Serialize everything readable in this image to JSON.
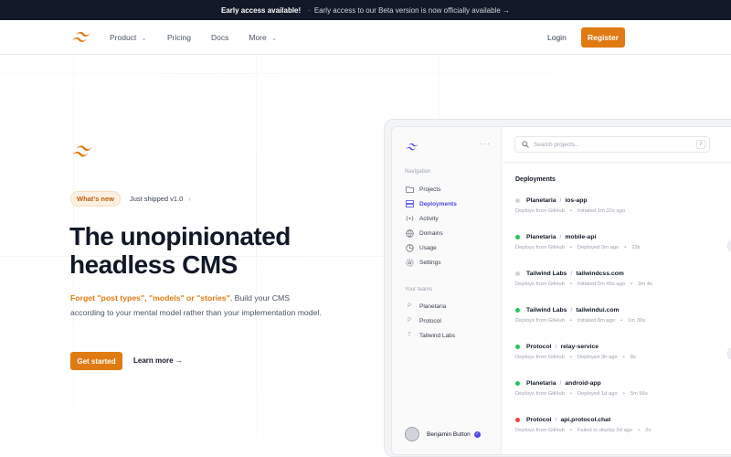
{
  "announcement": {
    "bold": "Early access available!",
    "message": "Early access to our Beta version is now officially available →"
  },
  "nav": {
    "links": [
      {
        "label": "Product",
        "has_menu": true
      },
      {
        "label": "Pricing",
        "has_menu": false
      },
      {
        "label": "Docs",
        "has_menu": false
      },
      {
        "label": "More",
        "has_menu": true
      }
    ],
    "login": "Login",
    "register": "Register"
  },
  "hero": {
    "badge": "What's new",
    "shipped": "Just shipped v1.0",
    "headline_line1": "The unopinionated",
    "headline_line2": "headless CMS",
    "sub_highlight": "Forget \"post types\", \"models\" or \"stories\".",
    "sub_rest": " Build your CMS according to your mental model rather than your implementation model.",
    "cta": "Get started",
    "learn_more": "Learn more →"
  },
  "app": {
    "search_placeholder": "Search projects...",
    "search_kbd": "/",
    "navigation_heading": "Navigation",
    "nav_items": [
      {
        "label": "Projects",
        "icon": "folder-icon",
        "active": false
      },
      {
        "label": "Deployments",
        "icon": "server-icon",
        "active": true
      },
      {
        "label": "Activity",
        "icon": "signal-icon",
        "active": false
      },
      {
        "label": "Domains",
        "icon": "globe-icon",
        "active": false
      },
      {
        "label": "Usage",
        "icon": "chart-icon",
        "active": false
      },
      {
        "label": "Settings",
        "icon": "gear-icon",
        "active": false
      }
    ],
    "teams_heading": "Your teams",
    "teams": [
      {
        "label": "Planetaria",
        "initial": "P"
      },
      {
        "label": "Protocol",
        "initial": "P"
      },
      {
        "label": "Tailwind Labs",
        "initial": "T"
      }
    ],
    "user_name": "Benjamin Button",
    "deployments_title": "Deployments",
    "deployments": [
      {
        "team": "Planetaria",
        "project": "ios-app",
        "status": "gray",
        "source": "Deploys from GitHub",
        "initiated": "Initiated 1m 32s ago",
        "duration": ""
      },
      {
        "team": "Planetaria",
        "project": "mobile-api",
        "status": "green",
        "source": "Deploys from GitHub",
        "initiated": "Deployed 3m ago",
        "duration": "23s"
      },
      {
        "team": "Tailwind Labs",
        "project": "tailwindcss.com",
        "status": "gray",
        "source": "Deploys from GitHub",
        "initiated": "Initiated 5m 45s ago",
        "duration": "3m 4s"
      },
      {
        "team": "Tailwind Labs",
        "project": "tailwindui.com",
        "status": "green",
        "source": "Deploys from GitHub",
        "initiated": "Initiated 8m ago",
        "duration": "1m 30s"
      },
      {
        "team": "Protocol",
        "project": "relay-service",
        "status": "green",
        "source": "Deploys from GitHub",
        "initiated": "Deployed 3h ago",
        "duration": "8s"
      },
      {
        "team": "Planetaria",
        "project": "android-app",
        "status": "green",
        "source": "Deploys from GitHub",
        "initiated": "Deployed 1d ago",
        "duration": "5m 56s"
      },
      {
        "team": "Protocol",
        "project": "api.protocol.chat",
        "status": "red",
        "source": "Deploys from GitHub",
        "initiated": "Failed to deploy 2d ago",
        "duration": "2s"
      }
    ]
  },
  "colors": {
    "accent": "#e07a12",
    "active": "#4f46e5",
    "green": "#22c55e",
    "red": "#ef4444",
    "gray": "#d1d5db"
  }
}
